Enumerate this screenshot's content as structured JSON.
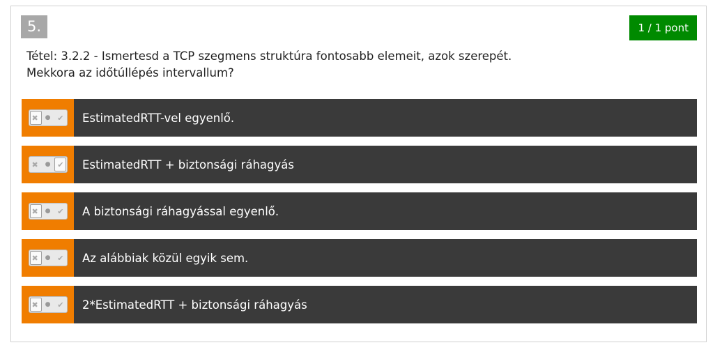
{
  "question": {
    "number": "5.",
    "score": "1 / 1 pont",
    "line1": "Tétel: 3.2.2 - Ismertesd a TCP szegmens struktúra fontosabb elemeit, azok szerepét.",
    "line2": "Mekkora az időtúllépés intervallum?"
  },
  "toggle_icons": {
    "no": "✖",
    "neutral": "●",
    "yes": "✔"
  },
  "answers": [
    {
      "label": "EstimatedRTT-vel egyenlő.",
      "state": "no"
    },
    {
      "label": "EstimatedRTT + biztonsági ráhagyás",
      "state": "yes"
    },
    {
      "label": "A biztonsági ráhagyással egyenlő.",
      "state": "no"
    },
    {
      "label": "Az alábbiak közül egyik sem.",
      "state": "no"
    },
    {
      "label": "2*EstimatedRTT + biztonsági ráhagyás",
      "state": "no"
    }
  ],
  "colors": {
    "accent": "#f07d00",
    "answer_bg": "#3a3a3a",
    "score_bg": "#008a00",
    "number_bg": "#a8a8a8"
  }
}
